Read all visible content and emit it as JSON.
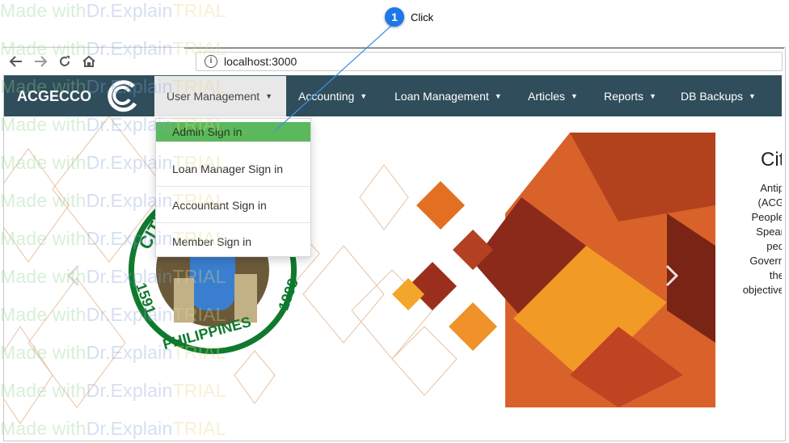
{
  "callout": {
    "number": "1",
    "label": "Click"
  },
  "browser": {
    "url": "localhost:3000",
    "back_icon": "arrow-left-icon",
    "forward_icon": "arrow-right-icon",
    "reload_icon": "reload-icon",
    "home_icon": "home-icon",
    "info_icon": "info-icon"
  },
  "navbar": {
    "brand": "ACGECCO",
    "items": [
      {
        "label": "User Management",
        "active": true
      },
      {
        "label": "Accounting"
      },
      {
        "label": "Loan Management"
      },
      {
        "label": "Articles"
      },
      {
        "label": "Reports"
      },
      {
        "label": "DB Backups"
      }
    ]
  },
  "dropdown": {
    "items": [
      {
        "label": "Admin Sign in"
      },
      {
        "label": "Loan Manager Sign in"
      },
      {
        "label": "Accountant Sign in"
      },
      {
        "label": "Member Sign in"
      }
    ]
  },
  "carousel": {
    "seal_text_top": "CITY",
    "seal_text_bottom": "PHILIPPINES",
    "seal_year_left": "1591",
    "seal_year_right": "1998",
    "heading": "Cit",
    "body_lines": [
      "Antip",
      "(ACG",
      "People",
      "Spear",
      "peo",
      "Govern",
      "the",
      "objective"
    ]
  },
  "watermark": {
    "made": "Made with ",
    "dr": "Dr.Explain ",
    "trial": "TRIAL"
  },
  "colors": {
    "navbar": "#2f4d5a",
    "highlight": "#5cb85c",
    "callout": "#1e77e6"
  }
}
